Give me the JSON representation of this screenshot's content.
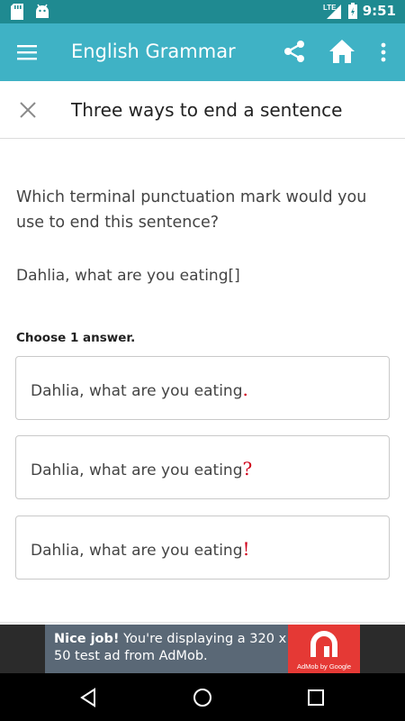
{
  "status_bar": {
    "network": "LTE",
    "time": "9:51",
    "icons": [
      "sd-card-icon",
      "android-icon",
      "signal-icon",
      "battery-icon"
    ]
  },
  "app_bar": {
    "title": "English Grammar",
    "icons": [
      "menu-icon",
      "share-icon",
      "home-icon",
      "more-vert-icon"
    ]
  },
  "lesson": {
    "title": "Three ways to end a sentence",
    "close_icon": "close-icon"
  },
  "question": {
    "prompt": "Which terminal punctuation mark would you use to end this sentence?",
    "sentence": "Dahlia, what are you eating[]",
    "instruction": "Choose 1 answer."
  },
  "options": [
    {
      "text": "Dahlia, what are you eating",
      "mark": "."
    },
    {
      "text": "Dahlia, what are you eating",
      "mark": "?"
    },
    {
      "text": "Dahlia, what are you eating",
      "mark": "!"
    }
  ],
  "ad": {
    "headline": "Nice job!",
    "body": " You're displaying a 320 x 50 test ad from AdMob.",
    "logo_caption": "AdMob by Google"
  },
  "nav_bar": {
    "icons": [
      "back-icon",
      "home-circle-icon",
      "recents-icon"
    ]
  },
  "colors": {
    "status_bar": "#1f8a91",
    "app_bar": "#3fb2c5",
    "answer_mark": "#d0021b",
    "ad_background": "#5a6876",
    "ad_logo": "#e53935"
  }
}
